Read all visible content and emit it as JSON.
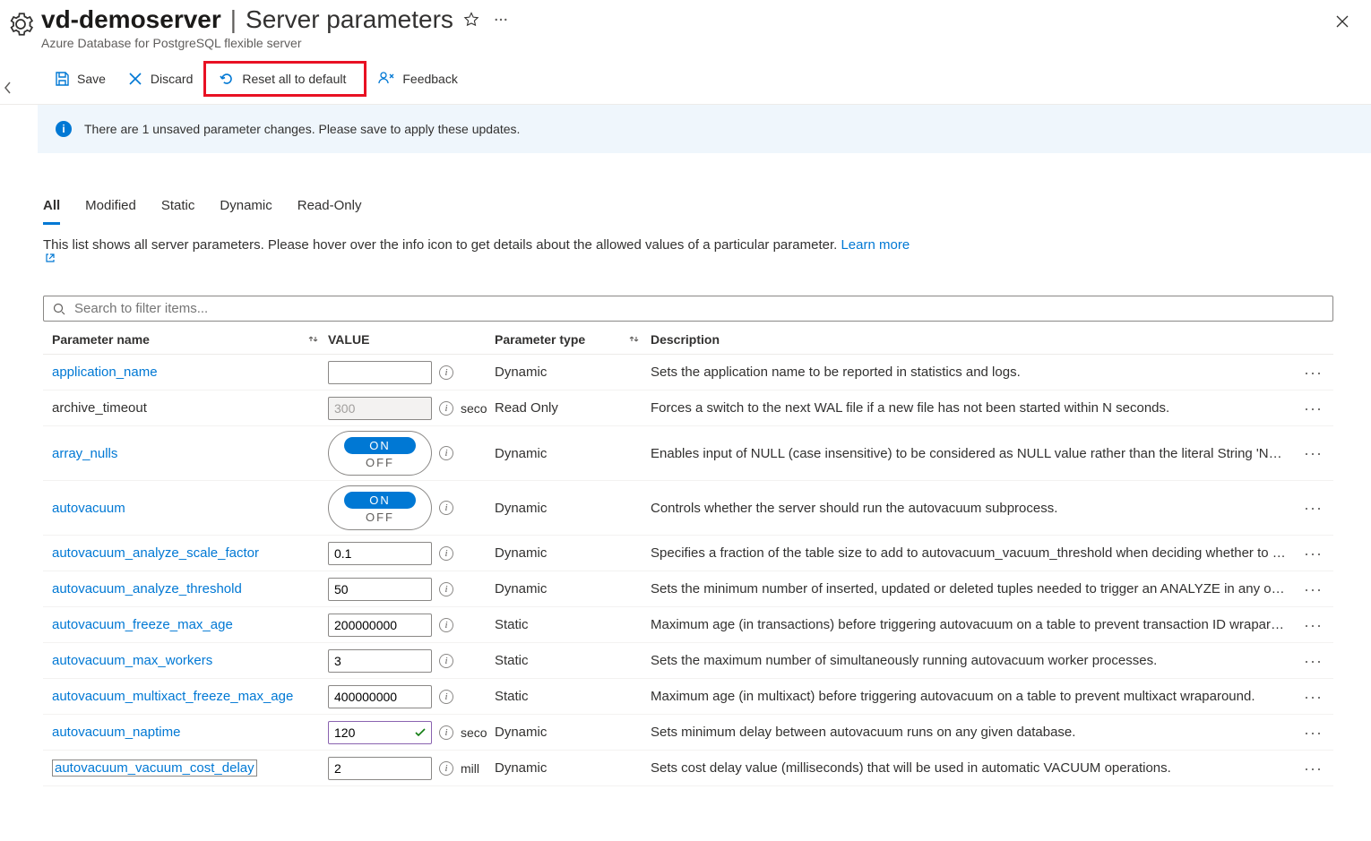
{
  "header": {
    "server_name": "vd-demoserver",
    "separator": "|",
    "section": "Server parameters",
    "subtitle": "Azure Database for PostgreSQL flexible server"
  },
  "toolbar": {
    "save": "Save",
    "discard": "Discard",
    "reset": "Reset all to default",
    "feedback": "Feedback"
  },
  "banner": {
    "message": "There are 1 unsaved parameter changes.  Please save to apply these updates."
  },
  "tabs": {
    "all": "All",
    "modified": "Modified",
    "static": "Static",
    "dynamic": "Dynamic",
    "readonly": "Read-Only"
  },
  "description_line": "This list shows all server parameters. Please hover over the info icon to get details about the allowed values of a particular parameter. ",
  "learn_more": "Learn more",
  "search_placeholder": "Search to filter items...",
  "columns": {
    "name": "Parameter name",
    "value": "VALUE",
    "type": "Parameter type",
    "desc": "Description"
  },
  "rows": [
    {
      "name": "application_name",
      "link": true,
      "value": "",
      "input": "text",
      "unit": "",
      "type": "Dynamic",
      "desc": "Sets the application name to be reported in statistics and logs."
    },
    {
      "name": "archive_timeout",
      "link": false,
      "value": "300",
      "input": "readonly",
      "unit": "seconds",
      "type": "Read Only",
      "desc": "Forces a switch to the next WAL file if a new file has not been started within N seconds."
    },
    {
      "name": "array_nulls",
      "link": true,
      "value": "ON",
      "input": "toggle",
      "unit": "",
      "type": "Dynamic",
      "desc": "Enables input of NULL (case insensitive) to be considered as NULL value rather than the literal String 'NULL'."
    },
    {
      "name": "autovacuum",
      "link": true,
      "value": "ON",
      "input": "toggle",
      "unit": "",
      "type": "Dynamic",
      "desc": "Controls whether the server should run the autovacuum subprocess."
    },
    {
      "name": "autovacuum_analyze_scale_factor",
      "link": true,
      "value": "0.1",
      "input": "text",
      "unit": "",
      "type": "Dynamic",
      "desc": "Specifies a fraction of the table size to add to autovacuum_vacuum_threshold when deciding whether to trigger a VACUUM."
    },
    {
      "name": "autovacuum_analyze_threshold",
      "link": true,
      "value": "50",
      "input": "text",
      "unit": "",
      "type": "Dynamic",
      "desc": "Sets the minimum number of inserted, updated or deleted tuples needed to trigger an ANALYZE in any one table."
    },
    {
      "name": "autovacuum_freeze_max_age",
      "link": true,
      "value": "200000000",
      "input": "text",
      "unit": "",
      "type": "Static",
      "desc": "Maximum age (in transactions) before triggering autovacuum on a table to prevent transaction ID wraparound."
    },
    {
      "name": "autovacuum_max_workers",
      "link": true,
      "value": "3",
      "input": "text",
      "unit": "",
      "type": "Static",
      "desc": "Sets the maximum number of simultaneously running autovacuum worker processes."
    },
    {
      "name": "autovacuum_multixact_freeze_max_age",
      "link": true,
      "value": "400000000",
      "input": "text",
      "unit": "",
      "type": "Static",
      "desc": "Maximum age (in multixact) before triggering autovacuum on a table to prevent multixact wraparound."
    },
    {
      "name": "autovacuum_naptime",
      "link": true,
      "value": "120",
      "input": "changed",
      "unit": "seconds",
      "type": "Dynamic",
      "desc": "Sets minimum delay between autovacuum runs on any given database."
    },
    {
      "name": "autovacuum_vacuum_cost_delay",
      "link": true,
      "boxed": true,
      "value": "2",
      "input": "text",
      "unit": "milliseconds",
      "type": "Dynamic",
      "desc": "Sets cost delay value (milliseconds) that will be used in automatic VACUUM operations."
    }
  ],
  "toggle_labels": {
    "on": "ON",
    "off": "OFF"
  }
}
